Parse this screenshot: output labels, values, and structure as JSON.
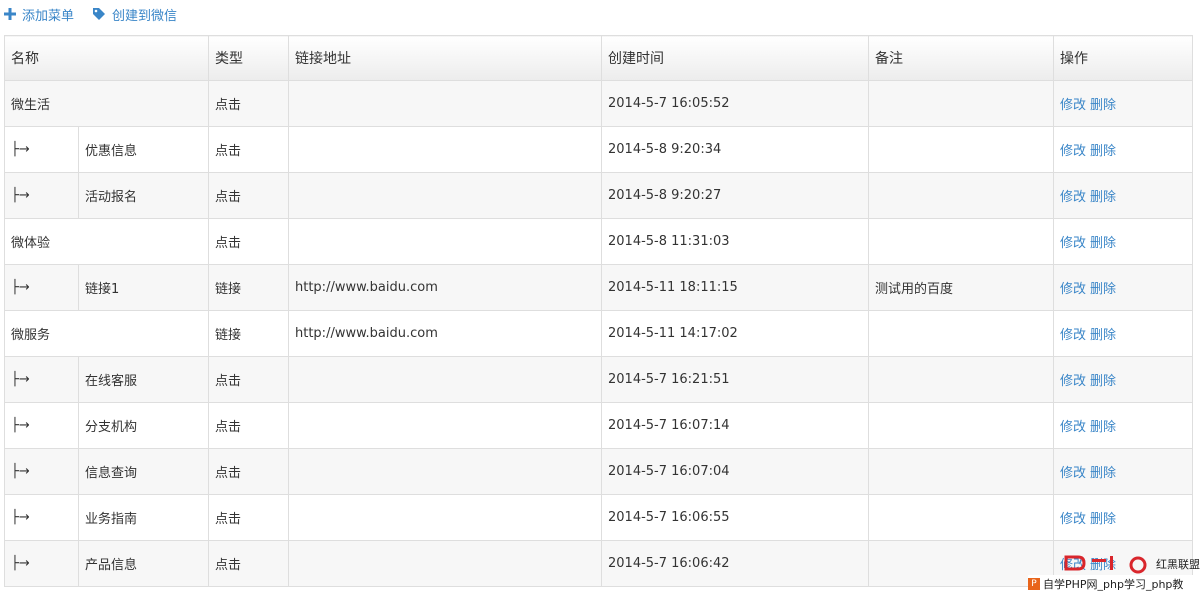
{
  "toolbar": {
    "add_menu_label": "添加菜单",
    "create_wechat_label": "创建到微信",
    "accent_color": "#3a86c8"
  },
  "table": {
    "headers": {
      "name": "名称",
      "type": "类型",
      "url": "链接地址",
      "created": "创建时间",
      "note": "备注",
      "actions": "操作"
    },
    "rows": [
      {
        "level": "parent",
        "prefix": "",
        "name": "微生活",
        "type": "点击",
        "url": "",
        "created": "2014-5-7 16:05:52",
        "note": "",
        "edit": "修改",
        "delete": "删除"
      },
      {
        "level": "child",
        "prefix": "├→",
        "name": "优惠信息",
        "type": "点击",
        "url": "",
        "created": "2014-5-8 9:20:34",
        "note": "",
        "edit": "修改",
        "delete": "删除"
      },
      {
        "level": "child",
        "prefix": "├→",
        "name": "活动报名",
        "type": "点击",
        "url": "",
        "created": "2014-5-8 9:20:27",
        "note": "",
        "edit": "修改",
        "delete": "删除"
      },
      {
        "level": "parent",
        "prefix": "",
        "name": "微体验",
        "type": "点击",
        "url": "",
        "created": "2014-5-8 11:31:03",
        "note": "",
        "edit": "修改",
        "delete": "删除"
      },
      {
        "level": "child",
        "prefix": "├→",
        "name": "链接1",
        "type": "链接",
        "url": "http://www.baidu.com",
        "created": "2014-5-11 18:11:15",
        "note": "测试用的百度",
        "edit": "修改",
        "delete": "删除"
      },
      {
        "level": "parent",
        "prefix": "",
        "name": "微服务",
        "type": "链接",
        "url": "http://www.baidu.com",
        "created": "2014-5-11 14:17:02",
        "note": "",
        "edit": "修改",
        "delete": "删除"
      },
      {
        "level": "child",
        "prefix": "├→",
        "name": "在线客服",
        "type": "点击",
        "url": "",
        "created": "2014-5-7 16:21:51",
        "note": "",
        "edit": "修改",
        "delete": "删除"
      },
      {
        "level": "child",
        "prefix": "├→",
        "name": "分支机构",
        "type": "点击",
        "url": "",
        "created": "2014-5-7 16:07:14",
        "note": "",
        "edit": "修改",
        "delete": "删除"
      },
      {
        "level": "child",
        "prefix": "├→",
        "name": "信息查询",
        "type": "点击",
        "url": "",
        "created": "2014-5-7 16:07:04",
        "note": "",
        "edit": "修改",
        "delete": "删除"
      },
      {
        "level": "child",
        "prefix": "├→",
        "name": "业务指南",
        "type": "点击",
        "url": "",
        "created": "2014-5-7 16:06:55",
        "note": "",
        "edit": "修改",
        "delete": "删除"
      },
      {
        "level": "child",
        "prefix": "├→",
        "name": "产品信息",
        "type": "点击",
        "url": "",
        "created": "2014-5-7 16:06:42",
        "note": "",
        "edit": "修改",
        "delete": "删除"
      }
    ]
  },
  "watermark": {
    "site_name": "红黑联盟",
    "slogan": "自学PHP网_php学习_php教",
    "badge": "P"
  }
}
